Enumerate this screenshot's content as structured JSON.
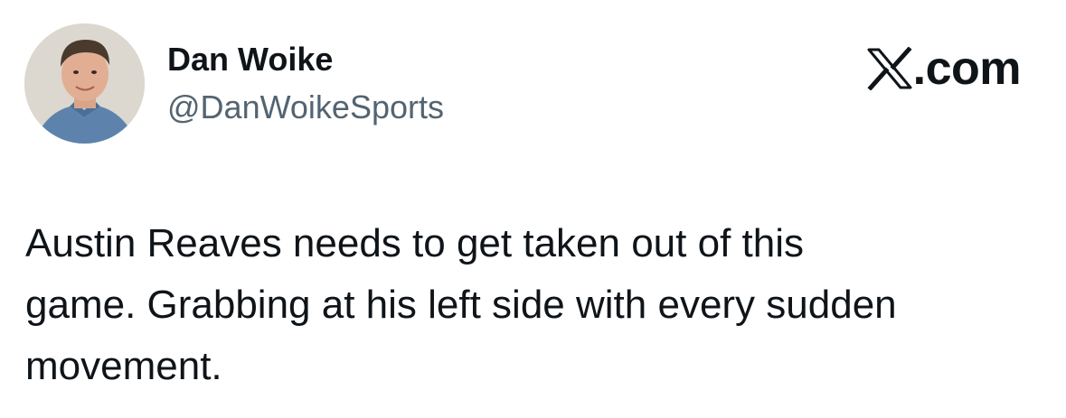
{
  "author": {
    "display_name": "Dan Woike",
    "handle": "@DanWoikeSports",
    "avatar_icon": "profile-photo"
  },
  "brand": {
    "logo_icon": "x-logo-icon",
    "text": ".com"
  },
  "tweet": {
    "text": "Austin Reaves needs to get taken out of this\ngame. Grabbing at his left side with every sudden\nmovement."
  },
  "colors": {
    "primary_text": "#0f1419",
    "secondary_text": "#536471",
    "background": "#ffffff"
  }
}
